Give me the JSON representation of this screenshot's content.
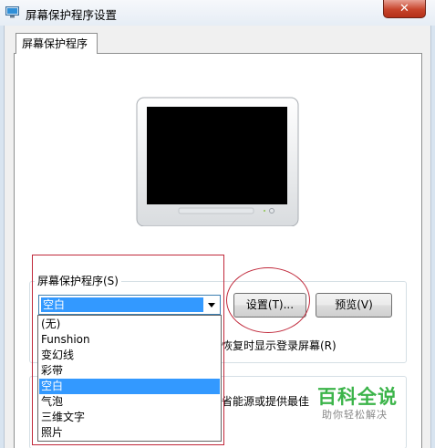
{
  "window": {
    "title": "屏幕保护程序设置",
    "close_label": "✕"
  },
  "tabs": [
    {
      "label": "屏幕保护程序"
    }
  ],
  "screensaver": {
    "group_label": "屏幕保护程序(S)",
    "selected_value": "空白",
    "settings_button": "设置(T)...",
    "preview_button": "预览(V)",
    "resume_checkbox_text": "恢复时显示登录屏幕(R)",
    "power_text_partial": "省能源或提供最佳"
  },
  "dropdown": {
    "options": [
      "(无)",
      "Funshion",
      "变幻线",
      "彩带",
      "空白",
      "气泡",
      "三维文字",
      "照片"
    ],
    "selected_index": 4
  },
  "watermark": {
    "title": "百科全说",
    "subtitle": "助你轻松解决"
  },
  "colors": {
    "selection": "#3399ff",
    "annotation": "#c0283a",
    "watermark": "#3cb44a",
    "close_button": "#c7442b"
  }
}
